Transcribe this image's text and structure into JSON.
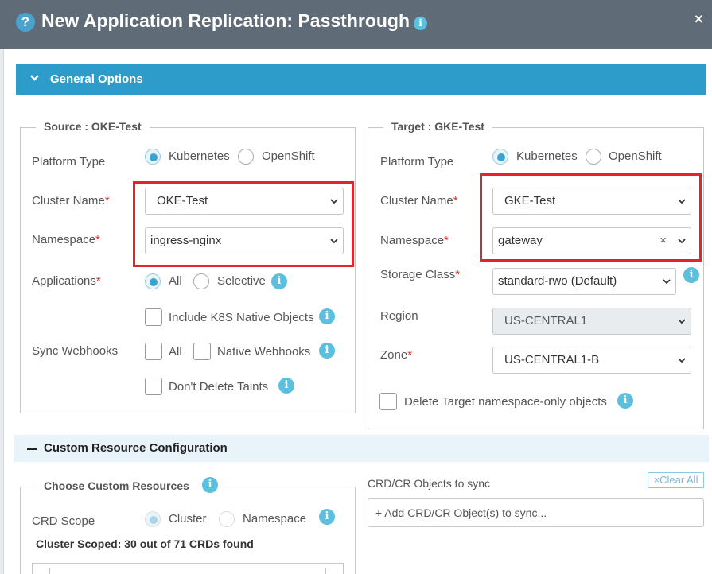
{
  "dialog": {
    "title": "New Application Replication: Passthrough",
    "close_glyph": "×",
    "help_glyph": "?",
    "info_glyph": "i"
  },
  "general": {
    "header": "General Options"
  },
  "source": {
    "legend": "Source : OKE-Test",
    "platform_label": "Platform Type",
    "platform_options": [
      "Kubernetes",
      "OpenShift"
    ],
    "platform_selected": "Kubernetes",
    "cluster_label": "Cluster Name",
    "cluster_value": "OKE-Test",
    "namespace_label": "Namespace",
    "namespace_value": "ingress-nginx",
    "applications_label": "Applications",
    "applications_options": [
      "All",
      "Selective"
    ],
    "applications_selected": "All",
    "include_k8s": "Include K8S Native Objects",
    "sync_webhooks_label": "Sync Webhooks",
    "webhook_all": "All",
    "webhook_native": "Native Webhooks",
    "dont_delete_taints": "Don't Delete Taints"
  },
  "target": {
    "legend": "Target : GKE-Test",
    "platform_label": "Platform Type",
    "platform_options": [
      "Kubernetes",
      "OpenShift"
    ],
    "platform_selected": "Kubernetes",
    "cluster_label": "Cluster Name",
    "cluster_value": "GKE-Test",
    "namespace_label": "Namespace",
    "namespace_value": "gateway",
    "clear_glyph": "×",
    "storage_label": "Storage Class",
    "storage_value": "standard-rwo (Default)",
    "region_label": "Region",
    "region_value": "US-CENTRAL1",
    "zone_label": "Zone",
    "zone_value": "US-CENTRAL1-B",
    "delete_ns_only": "Delete Target namespace-only objects"
  },
  "required_mark": "*",
  "custom": {
    "header": "Custom Resource Configuration",
    "choose_legend": "Choose Custom Resources",
    "scope_label": "CRD Scope",
    "scope_options": [
      "Cluster",
      "Namespace"
    ],
    "scope_selected": "Cluster",
    "scoped_count": "Cluster Scoped: 30 out of 71 CRDs found",
    "crd_objects_label": "CRD/CR Objects to sync",
    "clear_all": "Clear All",
    "clear_all_glyph": "×",
    "add_placeholder": "+ Add CRD/CR Object(s) to sync..."
  },
  "colors": {
    "titlebar": "#5f6b76",
    "accent": "#2d9ccb",
    "info": "#5bc0de",
    "required": "#e0262b",
    "highlight_box": "#e0262b"
  }
}
